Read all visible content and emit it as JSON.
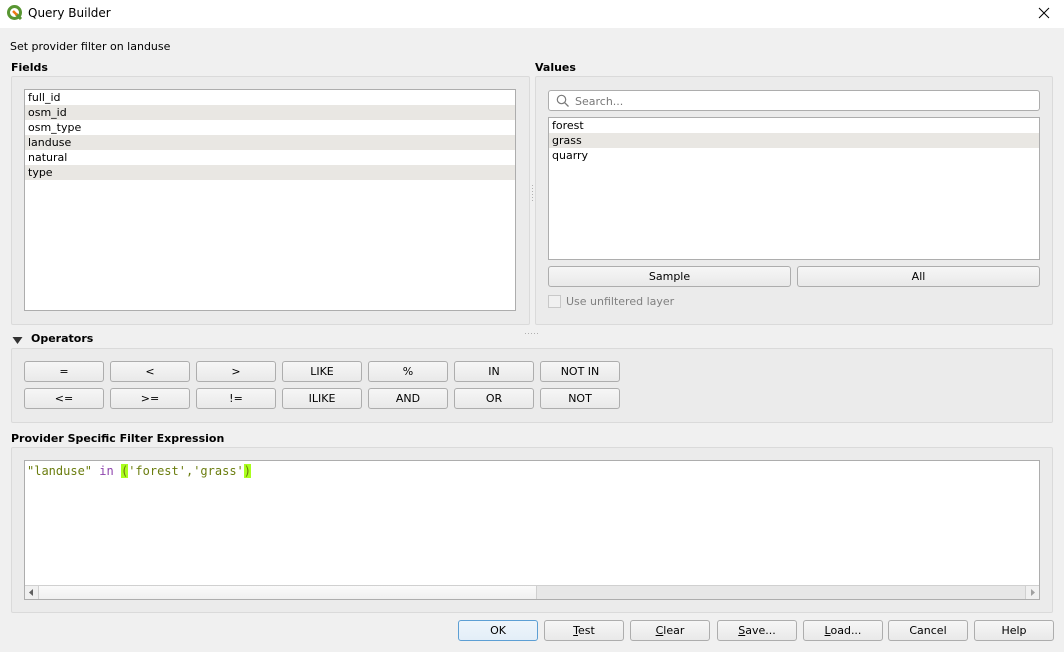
{
  "window": {
    "title": "Query Builder",
    "app_icon": "qgis-logo-icon",
    "close_icon": "close-icon"
  },
  "subtitle": "Set provider filter on landuse",
  "fields": {
    "label": "Fields",
    "items": [
      "full_id",
      "osm_id",
      "osm_type",
      "landuse",
      "natural",
      "type"
    ]
  },
  "values": {
    "label": "Values",
    "search_placeholder": "Search...",
    "search_value": "",
    "items": [
      "forest",
      "grass",
      "quarry"
    ],
    "sample_button": "Sample",
    "all_button": "All",
    "use_unfiltered_label": "Use unfiltered layer",
    "use_unfiltered_checked": false
  },
  "operators": {
    "label": "Operators",
    "expanded": true,
    "row1": [
      "=",
      "<",
      ">",
      "LIKE",
      "%",
      "IN",
      "NOT IN"
    ],
    "row2": [
      "<=",
      ">=",
      "!=",
      "ILIKE",
      "AND",
      "OR",
      "NOT"
    ]
  },
  "expression": {
    "label": "Provider Specific Filter Expression",
    "text": "\"landuse\" in ('forest','grass')",
    "tokens": {
      "field": "\"landuse\"",
      "space1": " ",
      "keyword": "in",
      "space2": " ",
      "open_paren": "(",
      "list": "'forest','grass'",
      "close_paren": ")"
    }
  },
  "buttons": {
    "ok": "OK",
    "test": "Test",
    "clear": "Clear",
    "save": "Save...",
    "load": "Load...",
    "cancel": "Cancel",
    "help": "Help"
  }
}
